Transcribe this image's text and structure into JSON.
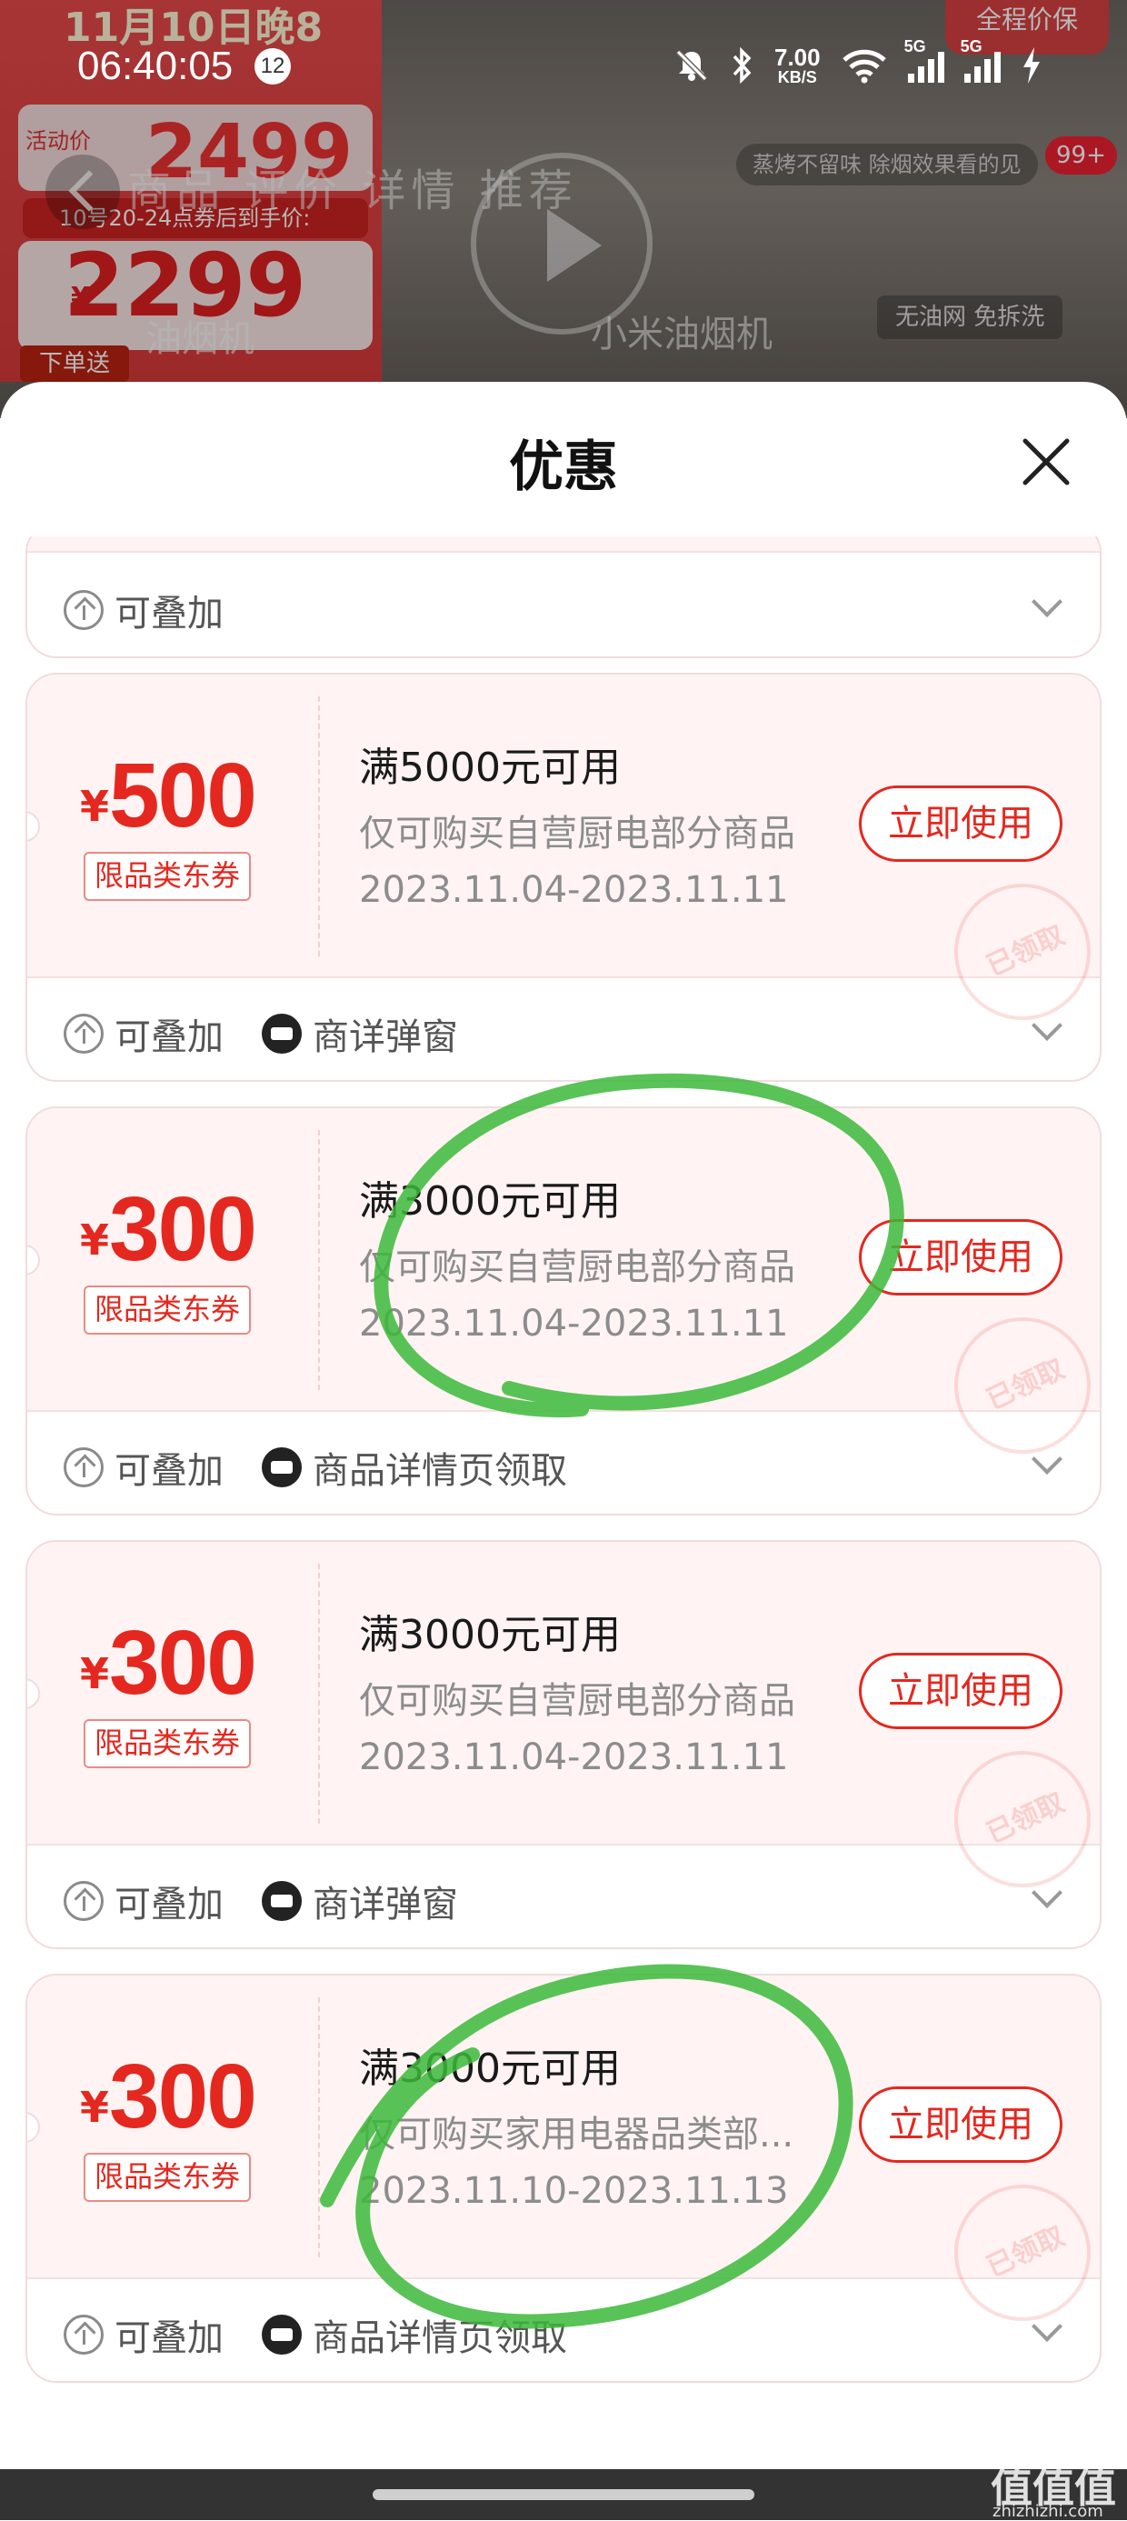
{
  "status_bar": {
    "time": "06:40:05",
    "notification_count": "12",
    "net_speed_value": "7.00",
    "net_speed_unit": "KB/S",
    "sim1_label": "5G",
    "sim2_label": "5G"
  },
  "background_page": {
    "banner_top": "11月10日晚8",
    "price_label": "活动价",
    "price_value": "2499",
    "promo_line": "10号20-24点券后到手价:",
    "final_yen": "¥",
    "final_price": "2299",
    "order_label": "下单送",
    "tabs": "商品  评价  详情  推荐",
    "product_left": "油烟机",
    "product_name": "小米油烟机",
    "chip_top": "蒸烤不留味 除烟效果看的见",
    "chip_bottom": "无油网 免拆洗",
    "badge": "99+",
    "top_right": "全程价保"
  },
  "sheet": {
    "title": "优惠",
    "close_icon": "close-icon"
  },
  "first_card": {
    "tag1": "可叠加"
  },
  "coupons": [
    {
      "yen": "¥",
      "amount": "500",
      "type_tag": "限品类东券",
      "condition": "满5000元可用",
      "scope": "仅可购买自营厨电部分商品",
      "validity": "2023.11.04-2023.11.11",
      "action": "立即使用",
      "stamp": "已领取",
      "tag_stack": "可叠加",
      "tag_source": "商详弹窗"
    },
    {
      "yen": "¥",
      "amount": "300",
      "type_tag": "限品类东券",
      "condition": "满3000元可用",
      "scope": "仅可购买自营厨电部分商品",
      "validity": "2023.11.04-2023.11.11",
      "action": "立即使用",
      "stamp": "已领取",
      "tag_stack": "可叠加",
      "tag_source": "商品详情页领取"
    },
    {
      "yen": "¥",
      "amount": "300",
      "type_tag": "限品类东券",
      "condition": "满3000元可用",
      "scope": "仅可购买自营厨电部分商品",
      "validity": "2023.11.04-2023.11.11",
      "action": "立即使用",
      "stamp": "已领取",
      "tag_stack": "可叠加",
      "tag_source": "商详弹窗"
    },
    {
      "yen": "¥",
      "amount": "300",
      "type_tag": "限品类东券",
      "condition": "满3000元可用",
      "scope": "仅可购买家用电器品类部...",
      "validity": "2023.11.10-2023.11.13",
      "action": "立即使用",
      "stamp": "已领取",
      "tag_stack": "可叠加",
      "tag_source": "商品详情页领取"
    }
  ],
  "watermark": {
    "text": "值值值",
    "url": "zhizhizhi.com"
  },
  "colors": {
    "accent_red": "#e4281f",
    "card_bg": "#fff4f3",
    "annotation_green": "#3cb83a"
  }
}
